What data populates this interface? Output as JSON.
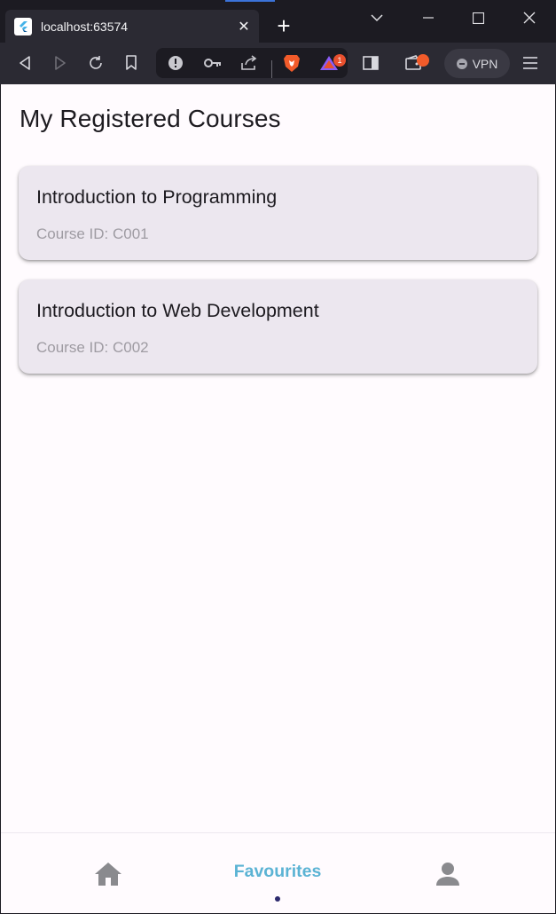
{
  "browser": {
    "tab_title": "localhost:63574",
    "new_tab_symbol": "+",
    "close_symbol": "✕",
    "vpn_label": "VPN",
    "notification_count": "1"
  },
  "page": {
    "title": "My Registered Courses"
  },
  "courses": [
    {
      "name": "Introduction to Programming",
      "id_text": "Course ID: C001"
    },
    {
      "name": "Introduction to Web Development",
      "id_text": "Course ID: C002"
    }
  ],
  "bottom_nav": {
    "items": [
      {
        "icon": "home-icon",
        "label": ""
      },
      {
        "icon": "favourites",
        "label": "Favourites",
        "selected": true
      },
      {
        "icon": "person-icon",
        "label": ""
      }
    ],
    "active_color": "#5bb3d4",
    "inactive_color": "#8a8a8e"
  }
}
